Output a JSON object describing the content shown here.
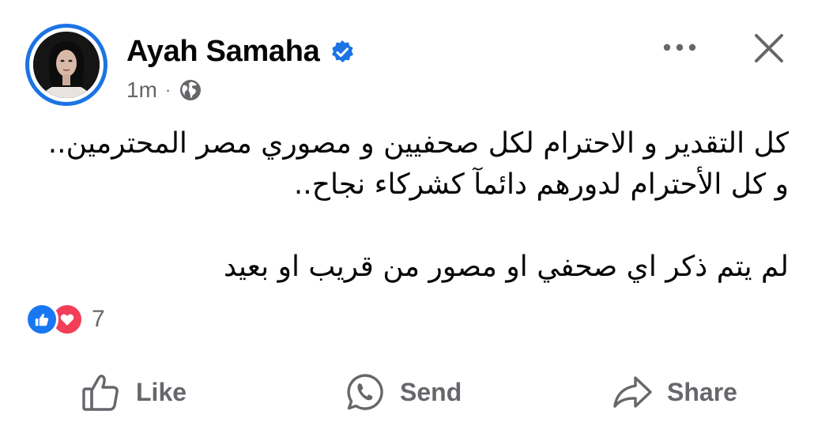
{
  "post": {
    "author": "Ayah Samaha",
    "time": "1m",
    "separator": "·",
    "verified": true,
    "audience_icon": "globe-icon",
    "body_lines": [
      "كل التقدير و الاحترام لكل صحفيين و مصوري مصر المحترمين..",
      "و كل الأحترام لدورهم دائمآ كشركاء نجاح..",
      "",
      "لم يتم ذكر اي صحفي او مصور من قريب او بعيد"
    ]
  },
  "reactions": {
    "types": [
      "like",
      "love"
    ],
    "count": "7"
  },
  "actions": {
    "like": "Like",
    "send": "Send",
    "share": "Share"
  },
  "colors": {
    "brand_blue": "#1877f2",
    "verified_blue": "#1b74e4",
    "love_red": "#f33e58",
    "secondary_text": "#65676b"
  },
  "icons": {
    "more": "more-horizontal-icon",
    "close": "close-icon",
    "like": "thumbs-up-icon",
    "send": "whatsapp-icon",
    "share": "share-arrow-icon"
  }
}
